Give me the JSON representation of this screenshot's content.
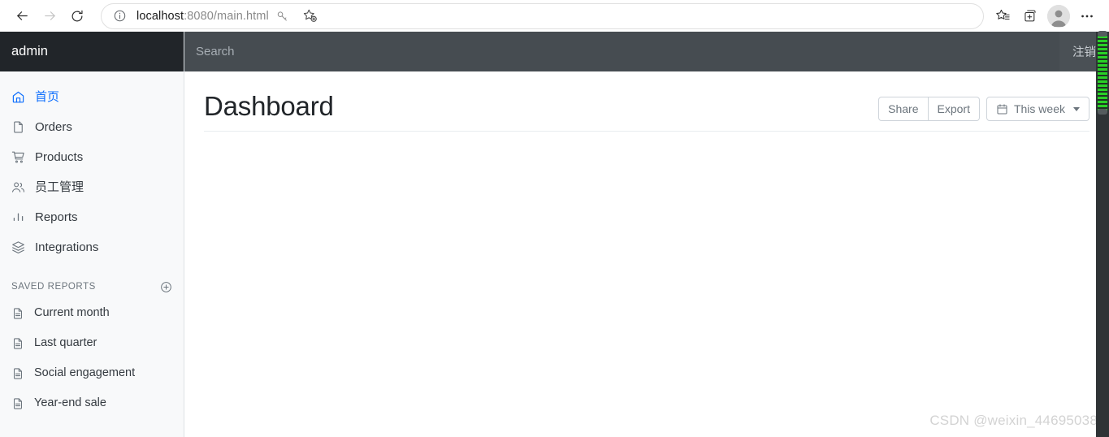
{
  "browser": {
    "back_icon": "arrow-left-icon",
    "forward_icon": "arrow-right-icon",
    "refresh_icon": "refresh-icon",
    "info_icon": "info-icon",
    "url_host": "localhost",
    "url_path": ":8080/main.html",
    "url_full": "localhost:8080/main.html",
    "actions": [
      {
        "name": "password-key-icon",
        "title": "Passwords"
      },
      {
        "name": "add-favorite-icon",
        "title": "Add this page to favorites"
      },
      {
        "name": "favorites-icon",
        "title": "Favorites"
      },
      {
        "name": "collections-icon",
        "title": "Collections"
      },
      {
        "name": "profile-avatar-icon",
        "title": "Profile"
      },
      {
        "name": "settings-more-icon",
        "title": "Settings and more"
      }
    ]
  },
  "sidebar": {
    "brand": "admin",
    "nav_items": [
      {
        "label": "首页",
        "icon": "home-icon",
        "active": true
      },
      {
        "label": "Orders",
        "icon": "file-icon",
        "active": false
      },
      {
        "label": "Products",
        "icon": "cart-icon",
        "active": false
      },
      {
        "label": "员工管理",
        "icon": "users-icon",
        "active": false
      },
      {
        "label": "Reports",
        "icon": "bar-chart-icon",
        "active": false
      },
      {
        "label": "Integrations",
        "icon": "layers-icon",
        "active": false
      }
    ],
    "saved_reports_heading": "SAVED REPORTS",
    "saved_reports_add_icon": "plus-circle-icon",
    "saved_reports": [
      {
        "label": "Current month",
        "icon": "file-text-icon"
      },
      {
        "label": "Last quarter",
        "icon": "file-text-icon"
      },
      {
        "label": "Social engagement",
        "icon": "file-text-icon"
      },
      {
        "label": "Year-end sale",
        "icon": "file-text-icon"
      }
    ]
  },
  "topbar": {
    "search_placeholder": "Search",
    "search_value": "",
    "logout_label": "注销"
  },
  "page": {
    "title": "Dashboard",
    "share_label": "Share",
    "export_label": "Export",
    "date_range_label": "This week",
    "date_range_icon": "calendar-icon",
    "dropdown_icon": "chevron-down-icon"
  },
  "watermark": "CSDN @weixin_44695038",
  "colors": {
    "sidebar_brand_bg": "#212529",
    "sidebar_bg": "#f8f9fa",
    "topbar_bg": "#4a5055",
    "search_bg": "#464c51",
    "accent": "#0d6efd",
    "muted_text": "#6c757d",
    "scrollbar_thumb": "#29d127",
    "scrollbar_track": "#2f3336"
  }
}
